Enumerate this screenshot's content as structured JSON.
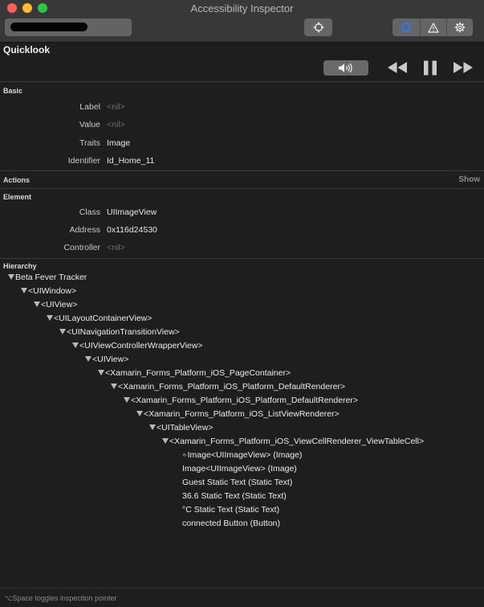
{
  "window": {
    "title": "Accessibility Inspector",
    "target_selector_value": "",
    "toolbar_icons": [
      "inspection-pointer-icon",
      "inspector-icon",
      "audit-warning-icon",
      "settings-icon"
    ],
    "accent_color": "#2b7cf0"
  },
  "quicklook": {
    "header": "Quicklook",
    "speak_icon": "speaker-icon",
    "media_icons": [
      "rewind-icon",
      "pause-icon",
      "fast-forward-icon"
    ]
  },
  "basic": {
    "header": "Basic",
    "rows": [
      {
        "label": "Label",
        "value": "<nil>"
      },
      {
        "label": "Value",
        "value": "<nil>"
      },
      {
        "label": "Traits",
        "value": "Image"
      },
      {
        "label": "Identifier",
        "value": "Id_Home_11"
      }
    ]
  },
  "actions": {
    "header": "Actions",
    "show_label": "Show"
  },
  "element": {
    "header": "Element",
    "rows": [
      {
        "label": "Class",
        "value": "UIImageView"
      },
      {
        "label": "Address",
        "value": "0x116d24530"
      },
      {
        "label": "Controller",
        "value": "<nil>"
      }
    ]
  },
  "hierarchy": {
    "header": "Hierarchy",
    "nodes": [
      {
        "text": "Beta Fever Tracker"
      },
      {
        "text": "<UIWindow>"
      },
      {
        "text": "<UIView>"
      },
      {
        "text": "<UILayoutContainerView>"
      },
      {
        "text": "<UINavigationTransitionView>"
      },
      {
        "text": "<UIViewControllerWrapperView>"
      },
      {
        "text": "<UIView>"
      },
      {
        "text": "<Xamarin_Forms_Platform_iOS_PageContainer>"
      },
      {
        "text": "<Xamarin_Forms_Platform_iOS_Platform_DefaultRenderer>"
      },
      {
        "text": "<Xamarin_Forms_Platform_iOS_Platform_DefaultRenderer>"
      },
      {
        "text": "<Xamarin_Forms_Platform_iOS_ListViewRenderer>"
      },
      {
        "text": "<UITableView>"
      },
      {
        "text": "<Xamarin_Forms_Platform_iOS_ViewCellRenderer_ViewTableCell>"
      },
      {
        "text": "Image<UIImageView> (Image)",
        "icon": "inspection-target-icon"
      },
      {
        "text": "Image<UIImageView> (Image)"
      },
      {
        "text": "Guest Static Text (Static Text)"
      },
      {
        "text": "36.6 Static Text (Static Text)"
      },
      {
        "text": "°C Static Text (Static Text)"
      },
      {
        "text": "connected Button (Button)"
      }
    ]
  },
  "footer": {
    "hint": "⌥Space toggles inspection pointer"
  }
}
